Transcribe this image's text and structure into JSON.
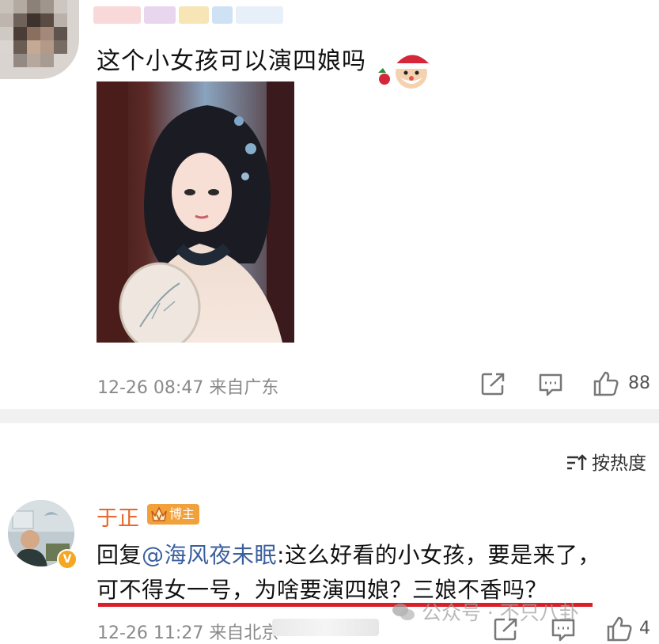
{
  "post": {
    "text": "这个小女孩可以演四娘吗",
    "meta_time": "12-26 08:47",
    "meta_from": "来自广东",
    "like_count": "88"
  },
  "sort": {
    "label": "按热度"
  },
  "reply": {
    "author": "于正",
    "badge": "博主",
    "prefix": "回复",
    "mention": "@海风夜未眠",
    "text1": ":这么好看的小女孩，要是来了，",
    "text2": "可不得女一号，为啥要演四娘？三娘不香吗？",
    "meta_time": "12-26 11:27",
    "meta_from": "来自北京",
    "like_count": "4"
  },
  "watermark": "公众号 · 不只八卦",
  "colors": {
    "accent_orange": "#e8672d",
    "mention_blue": "#3a5f9f",
    "underline_red": "#d9202a"
  }
}
